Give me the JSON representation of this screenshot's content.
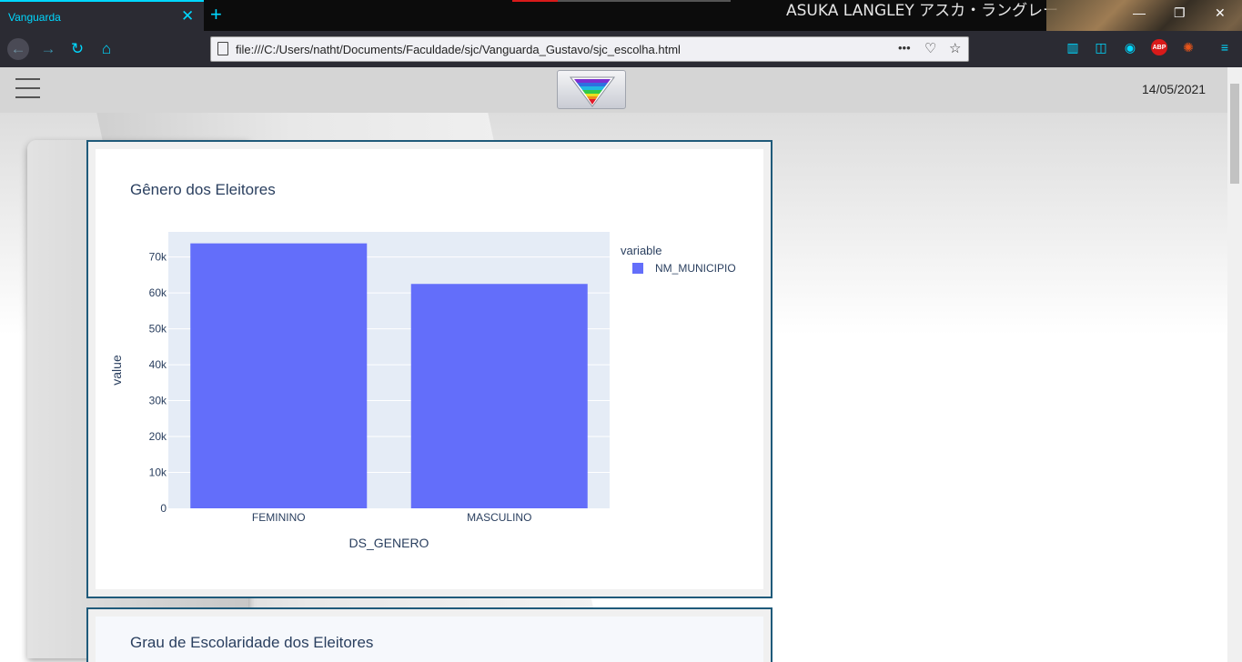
{
  "browser": {
    "tab_title": "Vanguarda",
    "tab_close": "✕",
    "new_tab": "+",
    "url": "file:///C:/Users/natht/Documents/Faculdade/sjc/Vanguarda_Gustavo/sjc_escolha.html",
    "theme_text": "ASUKA LANGLEY アスカ・ラングレー",
    "url_more": "•••",
    "abp_label": "ABP"
  },
  "header": {
    "date": "14/05/2021"
  },
  "chart1": {
    "title": "Gênero dos Eleitores"
  },
  "chart2": {
    "title": "Grau de Escolaridade dos Eleitores"
  },
  "chart_data": {
    "type": "bar",
    "title": "Gênero dos Eleitores",
    "categories": [
      "FEMININO",
      "MASCULINO"
    ],
    "series": [
      {
        "name": "NM_MUNICIPIO",
        "values": [
          73800,
          62500
        ],
        "color": "#636efa"
      }
    ],
    "xlabel": "DS_GENERO",
    "ylabel": "value",
    "ylim": [
      0,
      77000
    ],
    "yticks": [
      0,
      10000,
      20000,
      30000,
      40000,
      50000,
      60000,
      70000
    ],
    "ytick_labels": [
      "0",
      "10k",
      "20k",
      "30k",
      "40k",
      "50k",
      "60k",
      "70k"
    ],
    "legend_title": "variable",
    "legend_position": "top-right",
    "grid": true,
    "plot_bg": "#e5ecf6"
  }
}
